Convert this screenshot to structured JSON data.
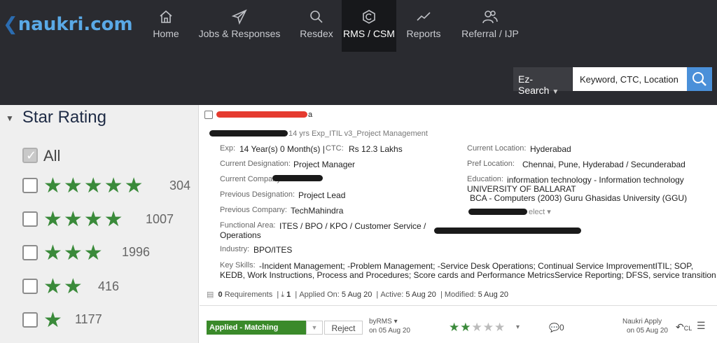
{
  "brand": {
    "logo_text": "naukri.com"
  },
  "nav": [
    {
      "label": "Home",
      "icon": "home-icon"
    },
    {
      "label": "Jobs & Responses",
      "icon": "send-icon"
    },
    {
      "label": "Resdex",
      "icon": "search-icon"
    },
    {
      "label": "RMS / CSM",
      "icon": "rms-icon"
    },
    {
      "label": "Reports",
      "icon": "chart-icon"
    },
    {
      "label": "Referral / IJP",
      "icon": "people-icon"
    }
  ],
  "search": {
    "mode": "Ez-Search",
    "placeholder": "Keyword, CTC, Location"
  },
  "sidebar": {
    "title": "Star Rating",
    "all_label": "All",
    "ratings": [
      {
        "stars": "★★★★★",
        "count": "304"
      },
      {
        "stars": "★★★★",
        "count": "1007"
      },
      {
        "stars": "★★★",
        "count": "1996"
      },
      {
        "stars": "★★",
        "count": "416"
      },
      {
        "stars": "★",
        "count": "1177"
      }
    ]
  },
  "candidate": {
    "name_suffix": "a",
    "headline": "14 yrs Exp_ITIL v3_Project Management",
    "exp_label": "Exp:",
    "exp_value": "14 Year(s) 0 Month(s) |",
    "ctc_label": "CTC:",
    "ctc_value": "Rs 12.3 Lakhs",
    "cur_desig_label": "Current Designation:",
    "cur_desig_value": "Project Manager",
    "cur_company_label": "Current Company:",
    "prev_desig_label": "Previous Designation:",
    "prev_desig_value": "Project Lead",
    "prev_company_label": "Previous Company:",
    "prev_company_value": "TechMahindra",
    "func_area_label": "Functional Area:",
    "func_area_value_1": "ITES / BPO / KPO / Customer Service /",
    "func_area_value_2": "Operations",
    "industry_label": "Industry:",
    "industry_value": "BPO/ITES",
    "skills_label": "Key Skills:",
    "skills_value_1": "-Incident Management; -Problem Management; -Service Desk Operations; Continual Service ImprovementITIL; SOP,",
    "skills_value_2": "KEDB, Work Instructions, Process and Procedures; Score cards and Performance MetricsService Reporting; DFSS, service transition",
    "cur_loc_label": "Current Location:",
    "cur_loc_value": "Hyderabad",
    "pref_loc_label": "Pref Location:",
    "pref_loc_value": "Chennai, Pune, Hyderabad / Secunderabad",
    "edu_label": "Education:",
    "edu_1": "information technology - Information technology",
    "edu_2": "UNIVERSITY OF BALLARAT",
    "edu_3": "BCA - Computers (2003) Guru Ghasidas University (GGU)",
    "select_label": "elect"
  },
  "meta": {
    "requirements": "0",
    "requirements_label": "Requirements",
    "downloads": "1",
    "applied_label": "Applied On:",
    "applied_value": "5 Aug 20",
    "active_label": "Active:",
    "active_value": "5 Aug 20",
    "modified_label": "Modified:",
    "modified_value": "5 Aug 20"
  },
  "actions": {
    "status": "Applied - Matching",
    "reject": "Reject",
    "by": "byRMS",
    "by_date": "on 05 Aug 20",
    "rating_stars_filled": 2,
    "comments": "0",
    "source": "Naukri Apply",
    "source_date": "on 05 Aug 20",
    "cl": "CL"
  },
  "colors": {
    "brand_blue": "#4a90d9",
    "star_green": "#3a8a3a",
    "status_green": "#3a8a2a",
    "topbar": "#2a2b30"
  }
}
